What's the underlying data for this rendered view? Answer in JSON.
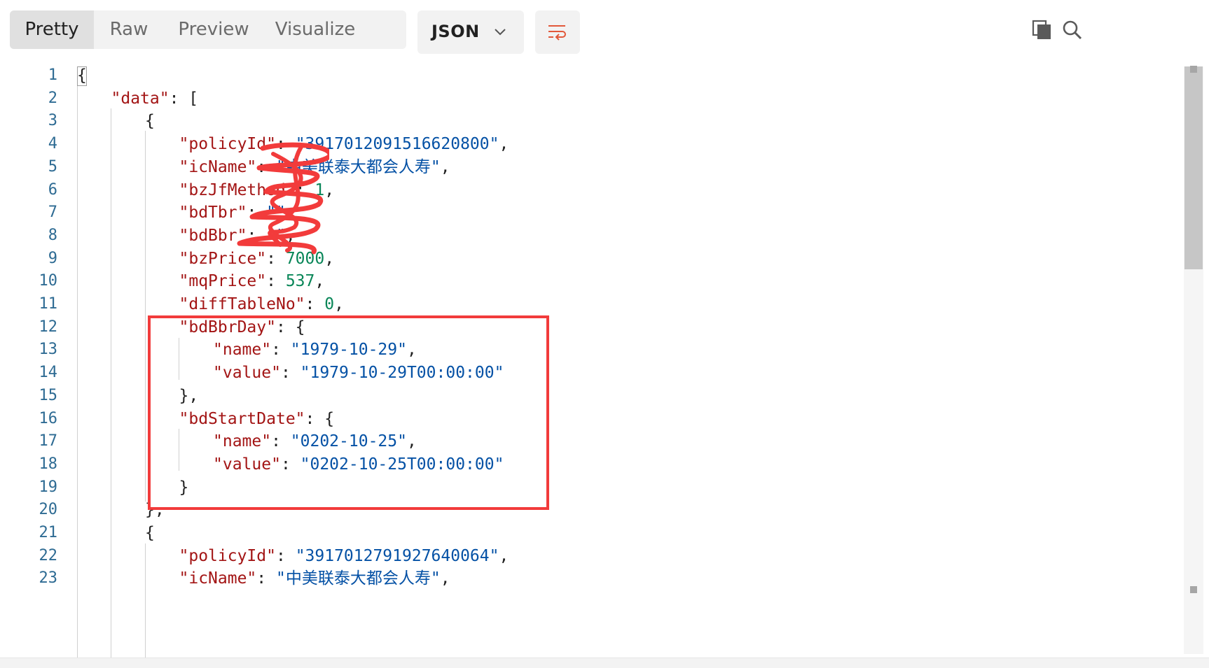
{
  "toolbar": {
    "tabs": [
      {
        "label": "Pretty",
        "active": true
      },
      {
        "label": "Raw",
        "active": false
      },
      {
        "label": "Preview",
        "active": false
      },
      {
        "label": "Visualize",
        "active": false
      }
    ],
    "format": "JSON"
  },
  "colors": {
    "key": "#a31515",
    "string": "#0451a5",
    "number": "#098658",
    "line_number": "#2e6b93",
    "highlight": "#f23b3b"
  },
  "editor": {
    "lines": [
      {
        "n": "1",
        "indent": 0,
        "tokens": [
          [
            "punc",
            "{"
          ]
        ]
      },
      {
        "n": "2",
        "indent": 1,
        "tokens": [
          [
            "key",
            "\"data\""
          ],
          [
            "punc",
            ": ["
          ]
        ]
      },
      {
        "n": "3",
        "indent": 2,
        "tokens": [
          [
            "punc",
            "{"
          ]
        ]
      },
      {
        "n": "4",
        "indent": 3,
        "tokens": [
          [
            "key",
            "\"policyId\""
          ],
          [
            "punc",
            ": "
          ],
          [
            "str",
            "\"3917012091516620800\""
          ],
          [
            "punc",
            ","
          ]
        ]
      },
      {
        "n": "5",
        "indent": 3,
        "tokens": [
          [
            "key",
            "\"icName\""
          ],
          [
            "punc",
            ": "
          ],
          [
            "str",
            "\"中美联泰大都会人寿\""
          ],
          [
            "punc",
            ","
          ]
        ]
      },
      {
        "n": "6",
        "indent": 3,
        "tokens": [
          [
            "key",
            "\"bzJfMethod\""
          ],
          [
            "punc",
            ": "
          ],
          [
            "num",
            "1"
          ],
          [
            "punc",
            ","
          ]
        ]
      },
      {
        "n": "7",
        "indent": 3,
        "tokens": [
          [
            "key",
            "\"bdTbr\""
          ],
          [
            "punc",
            ": "
          ],
          [
            "str",
            "\"\""
          ],
          [
            "punc",
            ","
          ]
        ]
      },
      {
        "n": "8",
        "indent": 3,
        "tokens": [
          [
            "key",
            "\"bdBbr\""
          ],
          [
            "punc",
            ": "
          ],
          [
            "str",
            "\"\""
          ],
          [
            "punc",
            ","
          ]
        ]
      },
      {
        "n": "9",
        "indent": 3,
        "tokens": [
          [
            "key",
            "\"bzPrice\""
          ],
          [
            "punc",
            ": "
          ],
          [
            "num",
            "7000"
          ],
          [
            "punc",
            ","
          ]
        ]
      },
      {
        "n": "10",
        "indent": 3,
        "tokens": [
          [
            "key",
            "\"mqPrice\""
          ],
          [
            "punc",
            ": "
          ],
          [
            "num",
            "537"
          ],
          [
            "punc",
            ","
          ]
        ]
      },
      {
        "n": "11",
        "indent": 3,
        "tokens": [
          [
            "key",
            "\"diffTableNo\""
          ],
          [
            "punc",
            ": "
          ],
          [
            "num",
            "0"
          ],
          [
            "punc",
            ","
          ]
        ]
      },
      {
        "n": "12",
        "indent": 3,
        "tokens": [
          [
            "key",
            "\"bdBbrDay\""
          ],
          [
            "punc",
            ": {"
          ]
        ]
      },
      {
        "n": "13",
        "indent": 4,
        "tokens": [
          [
            "key",
            "\"name\""
          ],
          [
            "punc",
            ": "
          ],
          [
            "str",
            "\"1979-10-29\""
          ],
          [
            "punc",
            ","
          ]
        ]
      },
      {
        "n": "14",
        "indent": 4,
        "tokens": [
          [
            "key",
            "\"value\""
          ],
          [
            "punc",
            ": "
          ],
          [
            "str",
            "\"1979-10-29T00:00:00\""
          ]
        ]
      },
      {
        "n": "15",
        "indent": 3,
        "tokens": [
          [
            "punc",
            "},"
          ]
        ]
      },
      {
        "n": "16",
        "indent": 3,
        "tokens": [
          [
            "key",
            "\"bdStartDate\""
          ],
          [
            "punc",
            ": {"
          ]
        ]
      },
      {
        "n": "17",
        "indent": 4,
        "tokens": [
          [
            "key",
            "\"name\""
          ],
          [
            "punc",
            ": "
          ],
          [
            "str",
            "\"0202-10-25\""
          ],
          [
            "punc",
            ","
          ]
        ]
      },
      {
        "n": "18",
        "indent": 4,
        "tokens": [
          [
            "key",
            "\"value\""
          ],
          [
            "punc",
            ": "
          ],
          [
            "str",
            "\"0202-10-25T00:00:00\""
          ]
        ]
      },
      {
        "n": "19",
        "indent": 3,
        "tokens": [
          [
            "punc",
            "}"
          ]
        ]
      },
      {
        "n": "20",
        "indent": 2,
        "tokens": [
          [
            "punc",
            "},"
          ]
        ]
      },
      {
        "n": "21",
        "indent": 2,
        "tokens": [
          [
            "punc",
            "{"
          ]
        ]
      },
      {
        "n": "22",
        "indent": 3,
        "tokens": [
          [
            "key",
            "\"policyId\""
          ],
          [
            "punc",
            ": "
          ],
          [
            "str",
            "\"3917012791927640064\""
          ],
          [
            "punc",
            ","
          ]
        ]
      },
      {
        "n": "23",
        "indent": 3,
        "tokens": [
          [
            "key",
            "\"icName\""
          ],
          [
            "punc",
            ": "
          ],
          [
            "str",
            "\"中美联泰大都会人寿\""
          ],
          [
            "punc",
            ","
          ]
        ]
      }
    ]
  }
}
